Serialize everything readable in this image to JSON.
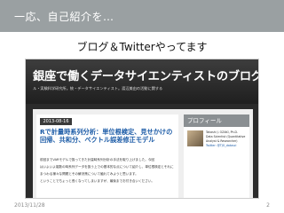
{
  "slide": {
    "title": "一応、自己紹介を…",
    "subtitle": "ブログ＆Twitterやってます",
    "footer_date": "2013/11/28",
    "page_number": "2"
  },
  "blog": {
    "title": "銀座で働くデータサイエンティストのブログ",
    "tagline": "ル・実験科学研究所。統・データサイエンティスト。渡辺美由の活動に関する",
    "post": {
      "date": "2013-08-16",
      "title": "Rで計量時系列分析：単位根検定、見せかけの回帰、共和分、ベクトル誤差修正モデル",
      "paragraphs": [
        "前回までVARモデルで扱ってきた計量時系列分析の手法を取り上げました。今回",
        "はいよいよ複数の時系列データを扱う上での基本的な点について紹介し、単位根検定とそれに",
        "まつわる様々な問題とその解決策について触れてみようと思います。",
        "ということでちょっと長くなってしまいますが、最後までお付き合いください。"
      ]
    },
    "sidebar": {
      "header": "プロフィール",
      "profile_lines": [
        "Takashi J. OZAKI, Ph.D.",
        "Data Scientist (Quantitative",
        "Analyst & Researcher)",
        "Twitter: @TJO_datasci"
      ]
    }
  },
  "colors": {
    "header_bg": "#9aa0a2",
    "blog_banner_bg": "#2b2b2b",
    "link": "#1a5aa6"
  }
}
